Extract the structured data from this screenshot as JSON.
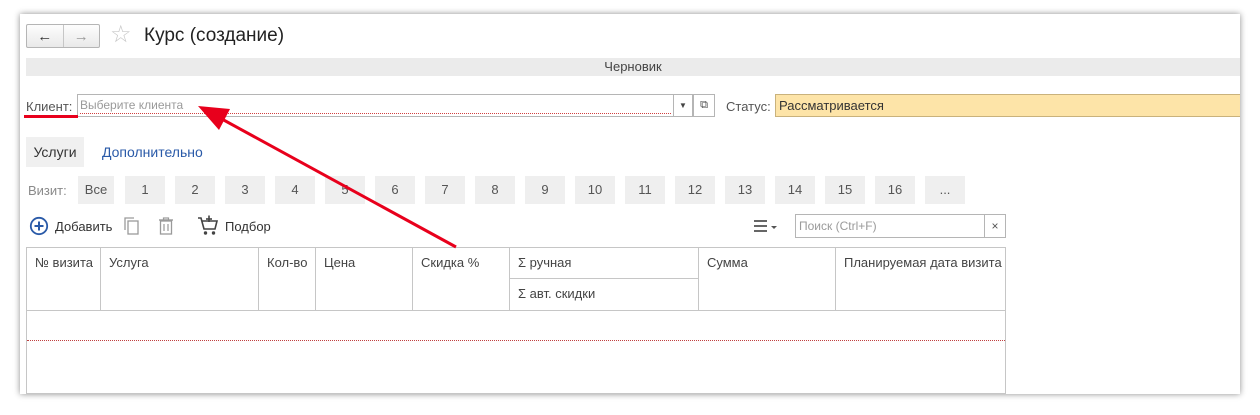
{
  "nav": {
    "back": "←",
    "forward": "→"
  },
  "window": {
    "title": "Курс (создание)"
  },
  "document_status": "Черновик",
  "client": {
    "label": "Клиент:",
    "placeholder": "Выберите клиента"
  },
  "status": {
    "label": "Статус:",
    "value": "Рассматривается"
  },
  "tabs": [
    {
      "label": "Услуги"
    },
    {
      "label": "Дополнительно"
    }
  ],
  "visits": {
    "label": "Визит:",
    "buttons": [
      "Все",
      "1",
      "2",
      "3",
      "4",
      "5",
      "6",
      "7",
      "8",
      "9",
      "10",
      "11",
      "12",
      "13",
      "14",
      "15",
      "16",
      "..."
    ]
  },
  "toolbar": {
    "add_label": "Добавить",
    "pick_label": "Подбор",
    "search_placeholder": "Поиск (Ctrl+F)",
    "clear": "×"
  },
  "table": {
    "columns": [
      "№ визита",
      "Услуга",
      "Кол-во",
      "Цена",
      "Скидка %",
      "Σ ручная",
      "Сумма",
      "Планируемая дата визита"
    ],
    "subcolumn": "Σ авт. скидки"
  },
  "colors": {
    "status_bg": "#fde4a8",
    "link": "#2a5aa8",
    "annotation": "#e8001c"
  }
}
